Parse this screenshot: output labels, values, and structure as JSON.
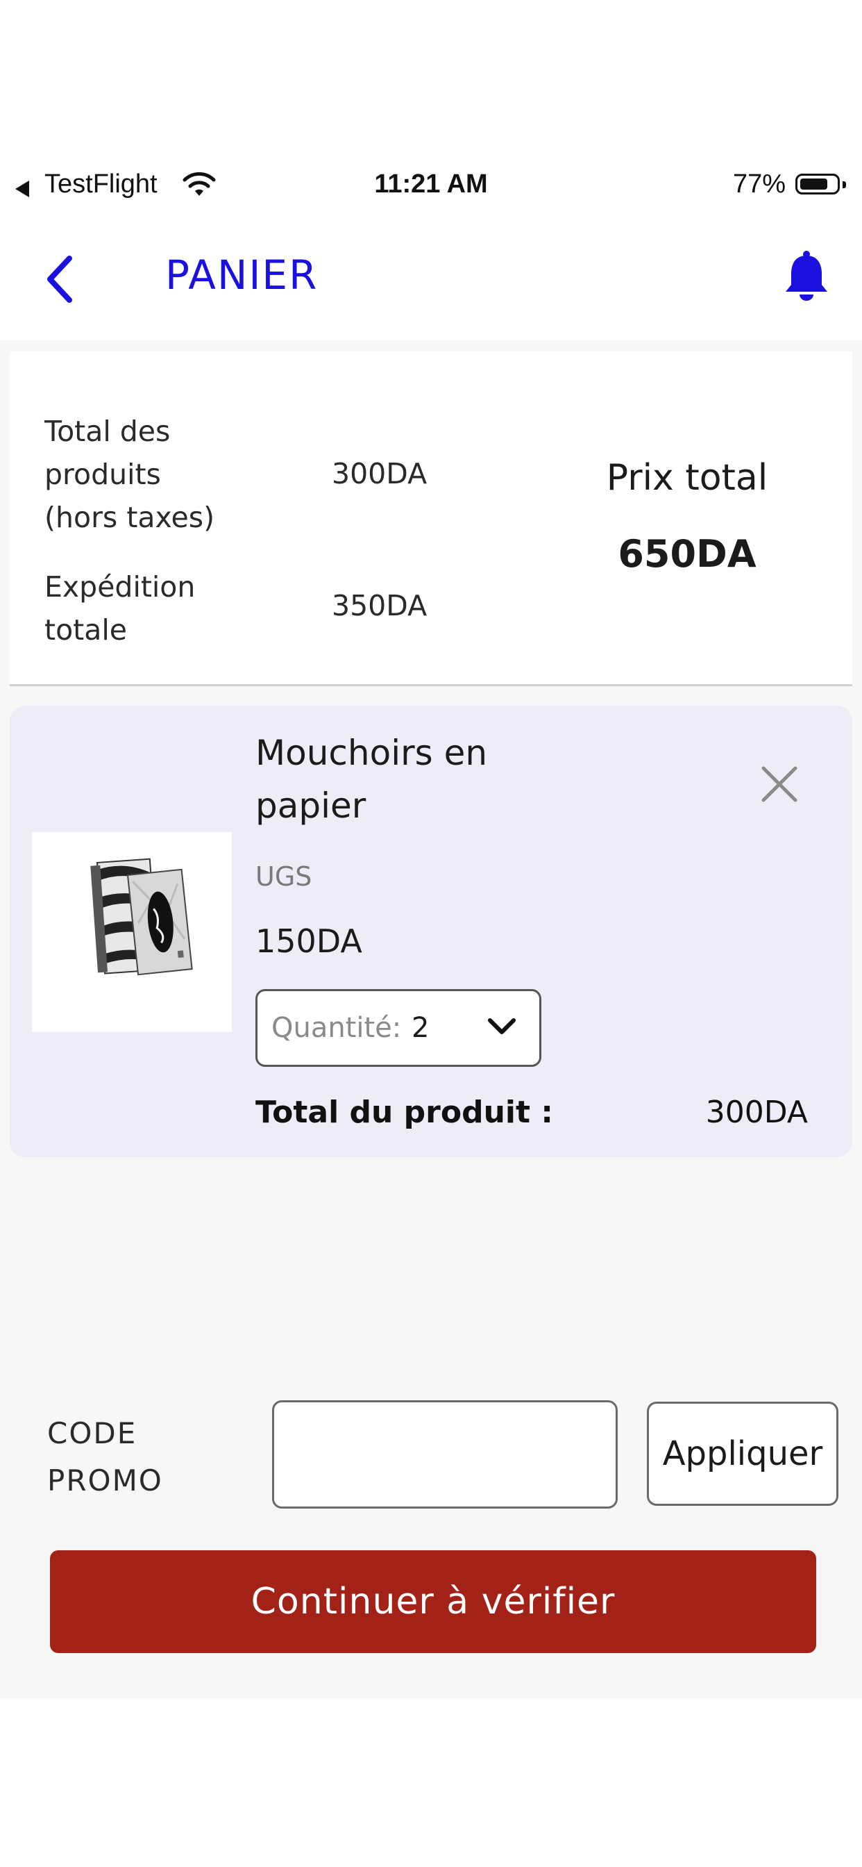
{
  "status_bar": {
    "app": "TestFlight",
    "time": "11:21 AM",
    "battery_percent": "77%",
    "battery_level": 0.77
  },
  "nav": {
    "title": "PANIER",
    "back_icon": "chevron-left-icon",
    "bell_icon": "bell-icon",
    "accent_color": "#1a10e0"
  },
  "summary": {
    "products_label": "Total des produits (hors taxes)",
    "products_label_lines": [
      "Total des",
      "produits",
      "(hors taxes)"
    ],
    "products_value": "300DA",
    "shipping_label_lines": [
      "Expédition",
      "totale"
    ],
    "shipping_value": "350DA",
    "total_title": "Prix total",
    "total_value": "650DA"
  },
  "cart": {
    "items": [
      {
        "name": "Mouchoirs en papier",
        "sku_label": "UGS",
        "price": "150DA",
        "quantity_label": "Quantité:",
        "quantity": "2",
        "line_total_label": "Total du produit :",
        "line_total": "300DA",
        "image_icon": "tissue-box-image"
      }
    ]
  },
  "promo": {
    "label_lines": [
      "CODE",
      "PROMO"
    ],
    "input_value": "",
    "apply_label": "Appliquer"
  },
  "checkout": {
    "label": "Continuer à vérifier",
    "color": "#a32218"
  }
}
